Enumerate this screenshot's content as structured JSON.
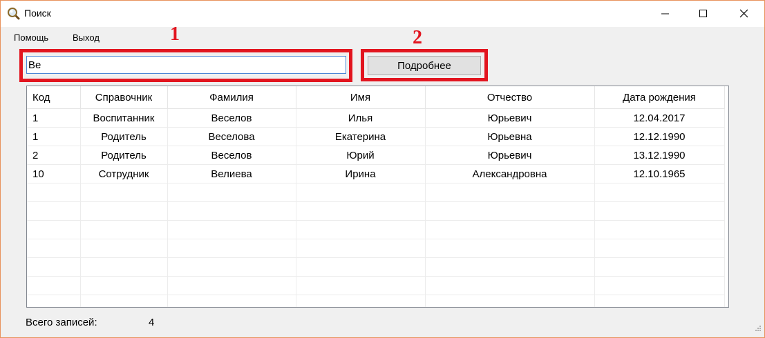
{
  "window": {
    "title": "Поиск"
  },
  "menu": [
    "Помощь",
    "Выход"
  ],
  "annotations": [
    "1",
    "2"
  ],
  "search": {
    "value": "Ве"
  },
  "details_button": "Подробнее",
  "table": {
    "columns": [
      "Код",
      "Справочник",
      "Фамилия",
      "Имя",
      "Отчество",
      "Дата рождения"
    ],
    "rows": [
      [
        "1",
        "Воспитанник",
        "Веселов",
        "Илья",
        "Юрьевич",
        "12.04.2017"
      ],
      [
        "1",
        "Родитель",
        "Веселова",
        "Екатерина",
        "Юрьевна",
        "12.12.1990"
      ],
      [
        "2",
        "Родитель",
        "Веселов",
        "Юрий",
        "Юрьевич",
        "13.12.1990"
      ],
      [
        "10",
        "Сотрудник",
        "Велиева",
        "Ирина",
        "Александровна",
        "12.10.1965"
      ]
    ]
  },
  "footer": {
    "label": "Всего записей:",
    "count": "4"
  },
  "colors": {
    "annotation": "#e2151f",
    "window_border": "#e8925c",
    "input_focus": "#4c86d6"
  },
  "icons": [
    "magnifier-icon",
    "minimize-icon",
    "maximize-icon",
    "close-icon",
    "resize-grip-icon"
  ]
}
